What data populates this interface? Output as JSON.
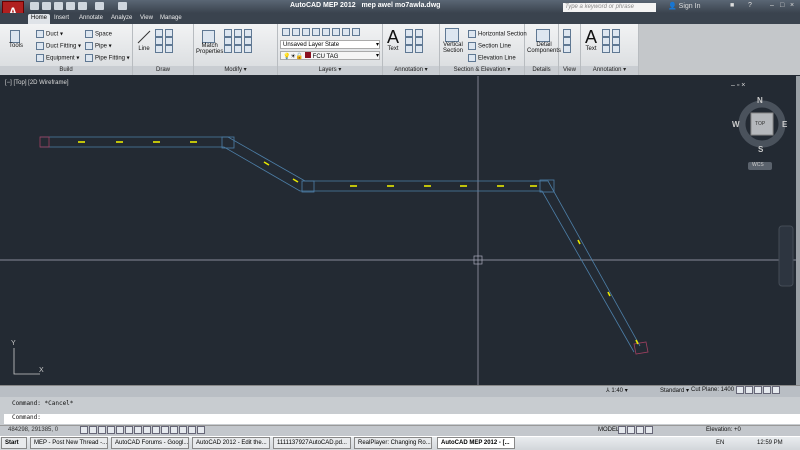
{
  "titlebar": {
    "app_title": "AutoCAD MEP 2012",
    "file": "mep awel mo7awla.dwg",
    "search_placeholder": "Type a keyword or phrase",
    "sign_in": "Sign In"
  },
  "tabs": [
    "Home",
    "Insert",
    "Annotate",
    "Analyze",
    "View",
    "Manage"
  ],
  "ribbon": {
    "build": {
      "tools": "Tools",
      "duct": "Duct",
      "duct_fitting": "Duct Fitting",
      "equipment": "Equipment",
      "space": "Space",
      "pipe": "Pipe",
      "pipe_fitting": "Pipe Fitting",
      "title": "Build"
    },
    "draw": {
      "line": "Line",
      "title": "Draw"
    },
    "modify": {
      "match1": "Match",
      "match2": "Properties",
      "title": "Modify"
    },
    "layers": {
      "layer_state": "Unsaved Layer State",
      "layer": "FCU TAG",
      "title": "Layers",
      "layer_color": "#8b1020"
    },
    "annotation": {
      "text": "Text",
      "title": "Annotation"
    },
    "section": {
      "vertical1": "Vertical",
      "vertical2": "Section",
      "horizontal": "Horizontal Section",
      "section_line": "Section Line",
      "elevation_line": "Elevation Line",
      "title": "Section & Elevation"
    },
    "details": {
      "detail1": "Detail",
      "detail2": "Components",
      "title": "Details"
    },
    "view": {
      "title": "View"
    },
    "annotation2": {
      "text": "Text",
      "title": "Annotation"
    }
  },
  "viewport": {
    "label": "[−] [Top] [2D Wireframe]",
    "viewcube": {
      "n": "N",
      "s": "S",
      "e": "E",
      "w": "W",
      "face": "TOP",
      "ucs": "WCS"
    },
    "ucs_y": "Y",
    "ucs_x": "X"
  },
  "vpstatus": {
    "scale": "1:40",
    "style": "Standard",
    "cut_plane": "Cut Plane: 1400"
  },
  "command": {
    "history": "Command: *Cancel*",
    "prompt": "Command:"
  },
  "statusbar": {
    "coords": "484298, 291385, 0",
    "model": "MODEL",
    "elevation": "Elevation: +0"
  },
  "taskbar": {
    "start": "Start",
    "tasks": [
      "MEP - Post New Thread -...",
      "AutoCAD Forums - Googl...",
      "AutoCAD 2012 - Edit the...",
      "1111137927AutoCAD.pd...",
      "RealPlayer: Changing Ro...",
      "AutoCAD MEP 2012 - [..."
    ],
    "lang": "EN",
    "time": "12:59 PM"
  }
}
